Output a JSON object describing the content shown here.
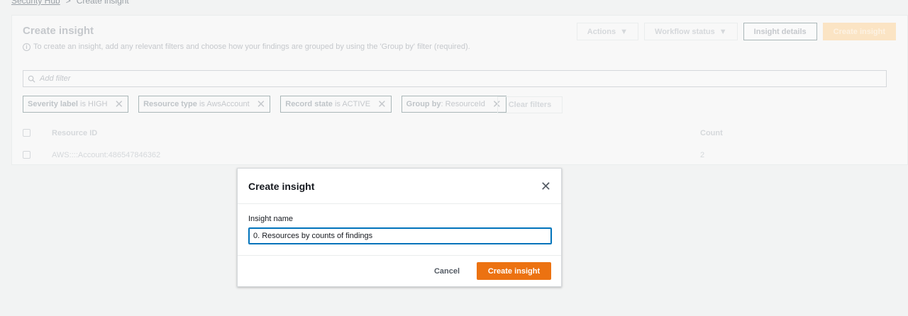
{
  "breadcrumb": {
    "parent": "Security Hub",
    "current": "Create insight"
  },
  "page": {
    "title": "Create insight",
    "info": "To create an insight, add any relevant filters and choose how your findings are grouped by using the 'Group by' filter (required).",
    "toolbar": {
      "actions": "Actions",
      "workflow_status": "Workflow status",
      "insight_details": "Insight details",
      "create_insight": "Create insight"
    },
    "filter_placeholder": "Add filter",
    "chips": [
      {
        "key": "Severity label",
        "op": " is ",
        "value": "HIGH"
      },
      {
        "key": "Resource type",
        "op": " is ",
        "value": "AwsAccount"
      },
      {
        "key": "Record state",
        "op": " is ",
        "value": "ACTIVE"
      },
      {
        "key": "Group by",
        "op": ": ",
        "value": "ResourceId"
      }
    ],
    "clear_filters": "Clear filters",
    "table": {
      "headers": [
        "Resource ID",
        "Count"
      ],
      "rows": [
        {
          "resource_id": "AWS::::Account:486547846362",
          "count": "2"
        }
      ]
    }
  },
  "modal": {
    "title": "Create insight",
    "field_label": "Insight name",
    "input_value": "0. Resources by counts of findings",
    "cancel": "Cancel",
    "submit": "Create insight"
  },
  "colors": {
    "accent": "#ec7211",
    "focus": "#0073bb"
  }
}
